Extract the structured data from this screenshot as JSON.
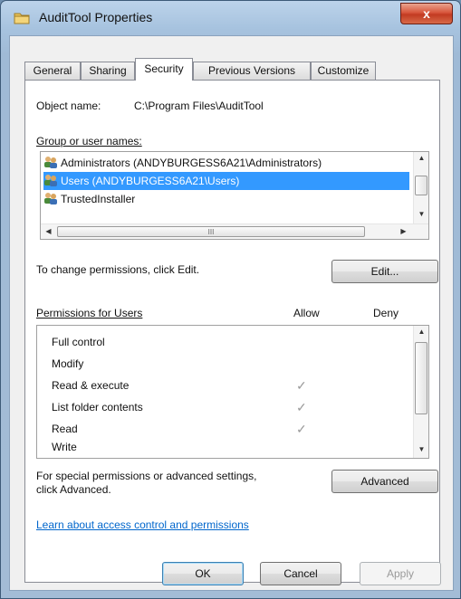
{
  "window": {
    "title": "AuditTool Properties",
    "close_label": "x"
  },
  "tabs": [
    {
      "label": "General"
    },
    {
      "label": "Sharing"
    },
    {
      "label": "Security",
      "active": true
    },
    {
      "label": "Previous Versions"
    },
    {
      "label": "Customize"
    }
  ],
  "object_name": {
    "label": "Object name:",
    "value": "C:\\Program Files\\AuditTool"
  },
  "groups": {
    "label": "Group or user names:",
    "items": [
      {
        "label": "Administrators (ANDYBURGESS6A21\\Administrators)"
      },
      {
        "label": "Users (ANDYBURGESS6A21\\Users)",
        "selected": true
      },
      {
        "label": "TrustedInstaller"
      }
    ],
    "hscroll_grip": "III"
  },
  "change_permissions": {
    "text": "To change permissions, click Edit.",
    "edit_button": "Edit..."
  },
  "permissions": {
    "title": "Permissions for Users",
    "allow_header": "Allow",
    "deny_header": "Deny",
    "rows": [
      {
        "name": "Full control",
        "allow": false,
        "deny": false
      },
      {
        "name": "Modify",
        "allow": false,
        "deny": false
      },
      {
        "name": "Read & execute",
        "allow": true,
        "deny": false
      },
      {
        "name": "List folder contents",
        "allow": true,
        "deny": false
      },
      {
        "name": "Read",
        "allow": true,
        "deny": false
      },
      {
        "name": "Write",
        "allow": false,
        "deny": false
      }
    ],
    "check_glyph": "✓"
  },
  "special": {
    "text_line1": "For special permissions or advanced settings,",
    "text_line2": "click Advanced.",
    "advanced_button": "Advanced"
  },
  "learn_link": "Learn about access control and permissions",
  "footer": {
    "ok": "OK",
    "cancel": "Cancel",
    "apply": "Apply"
  },
  "colors": {
    "selection": "#3399ff",
    "link": "#0066cc",
    "close_button": "#c23a22"
  }
}
